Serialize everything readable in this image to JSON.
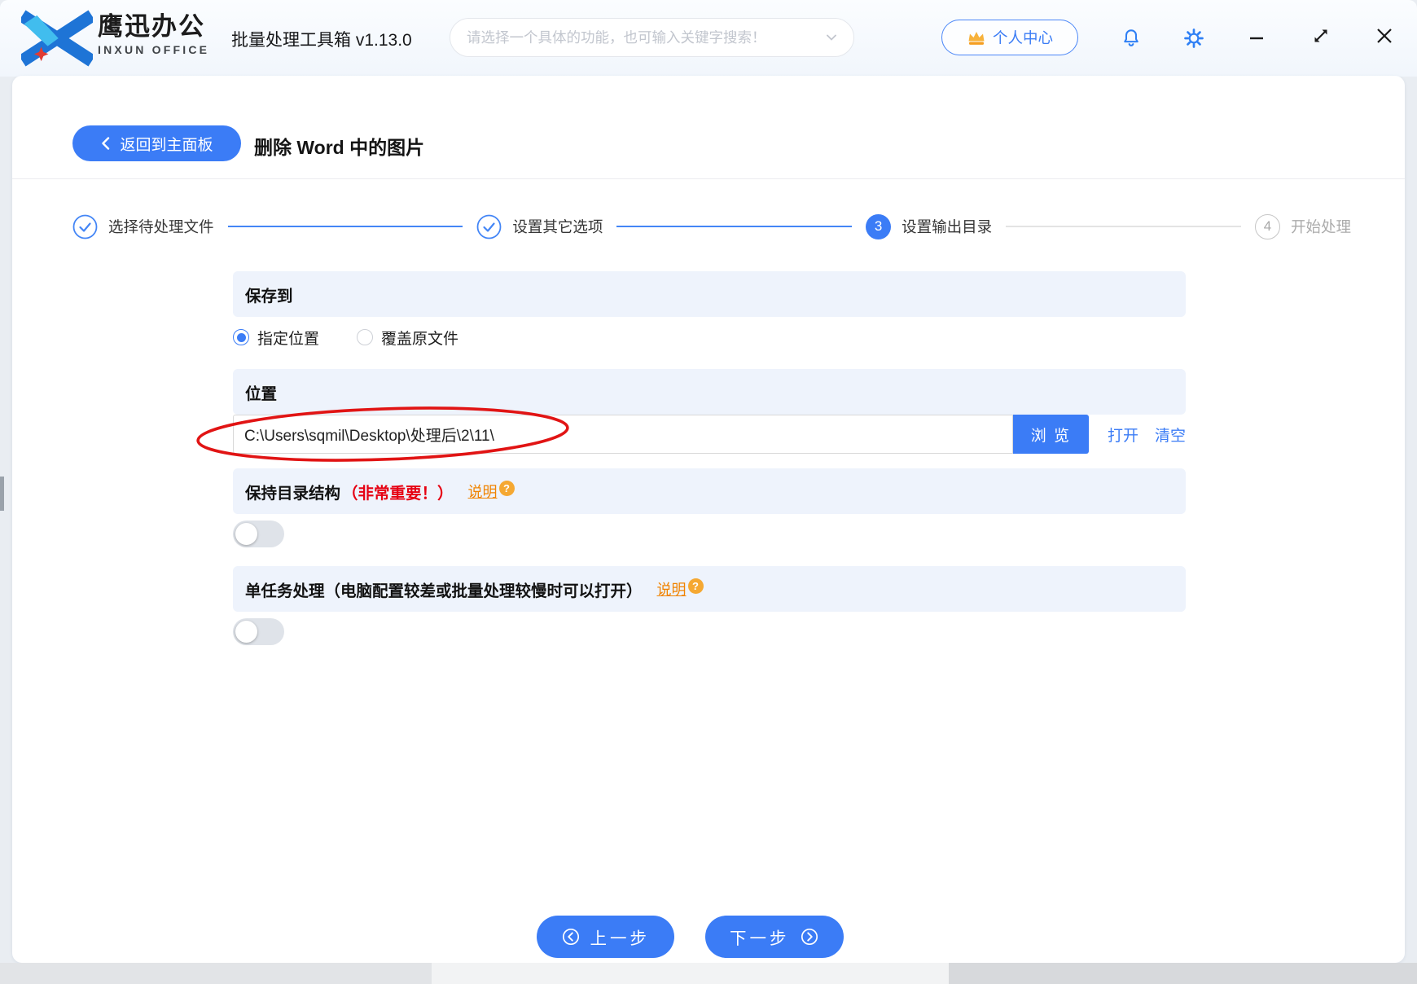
{
  "app": {
    "brand_cn": "鹰迅办公",
    "brand_en": "INXUN OFFICE",
    "title": "批量处理工具箱 v1.13.0"
  },
  "topbar": {
    "search_placeholder": "请选择一个具体的功能，也可输入关键字搜索！",
    "user_center": "个人中心"
  },
  "header": {
    "back": "返回到主面板",
    "page_title": "删除 Word 中的图片"
  },
  "stepper": {
    "steps": [
      {
        "label": "选择待处理文件",
        "state": "done"
      },
      {
        "label": "设置其它选项",
        "state": "done"
      },
      {
        "label": "设置输出目录",
        "state": "active",
        "number": "3"
      },
      {
        "label": "开始处理",
        "state": "pending",
        "number": "4"
      }
    ]
  },
  "form": {
    "save_to": {
      "title": "保存到",
      "options": [
        {
          "label": "指定位置",
          "selected": true
        },
        {
          "label": "覆盖原文件",
          "selected": false
        }
      ]
    },
    "location": {
      "title": "位置",
      "path": "C:\\Users\\sqmil\\Desktop\\处理后\\2\\11\\",
      "browse": "浏 览",
      "open": "打开",
      "clear": "清空"
    },
    "keep_structure": {
      "title": "保持目录结构",
      "important": "（非常重要！）",
      "help": "说明",
      "help_q": "?",
      "enabled": false
    },
    "single_task": {
      "title": "单任务处理（电脑配置较差或批量处理较慢时可以打开）",
      "help": "说明",
      "help_q": "?",
      "enabled": false
    }
  },
  "footer": {
    "prev": "上一步",
    "next": "下一步"
  },
  "colors": {
    "accent": "#3b7cf6",
    "danger": "#e60012",
    "help_orange": "#f08300",
    "section_bg": "#eef3fc"
  }
}
